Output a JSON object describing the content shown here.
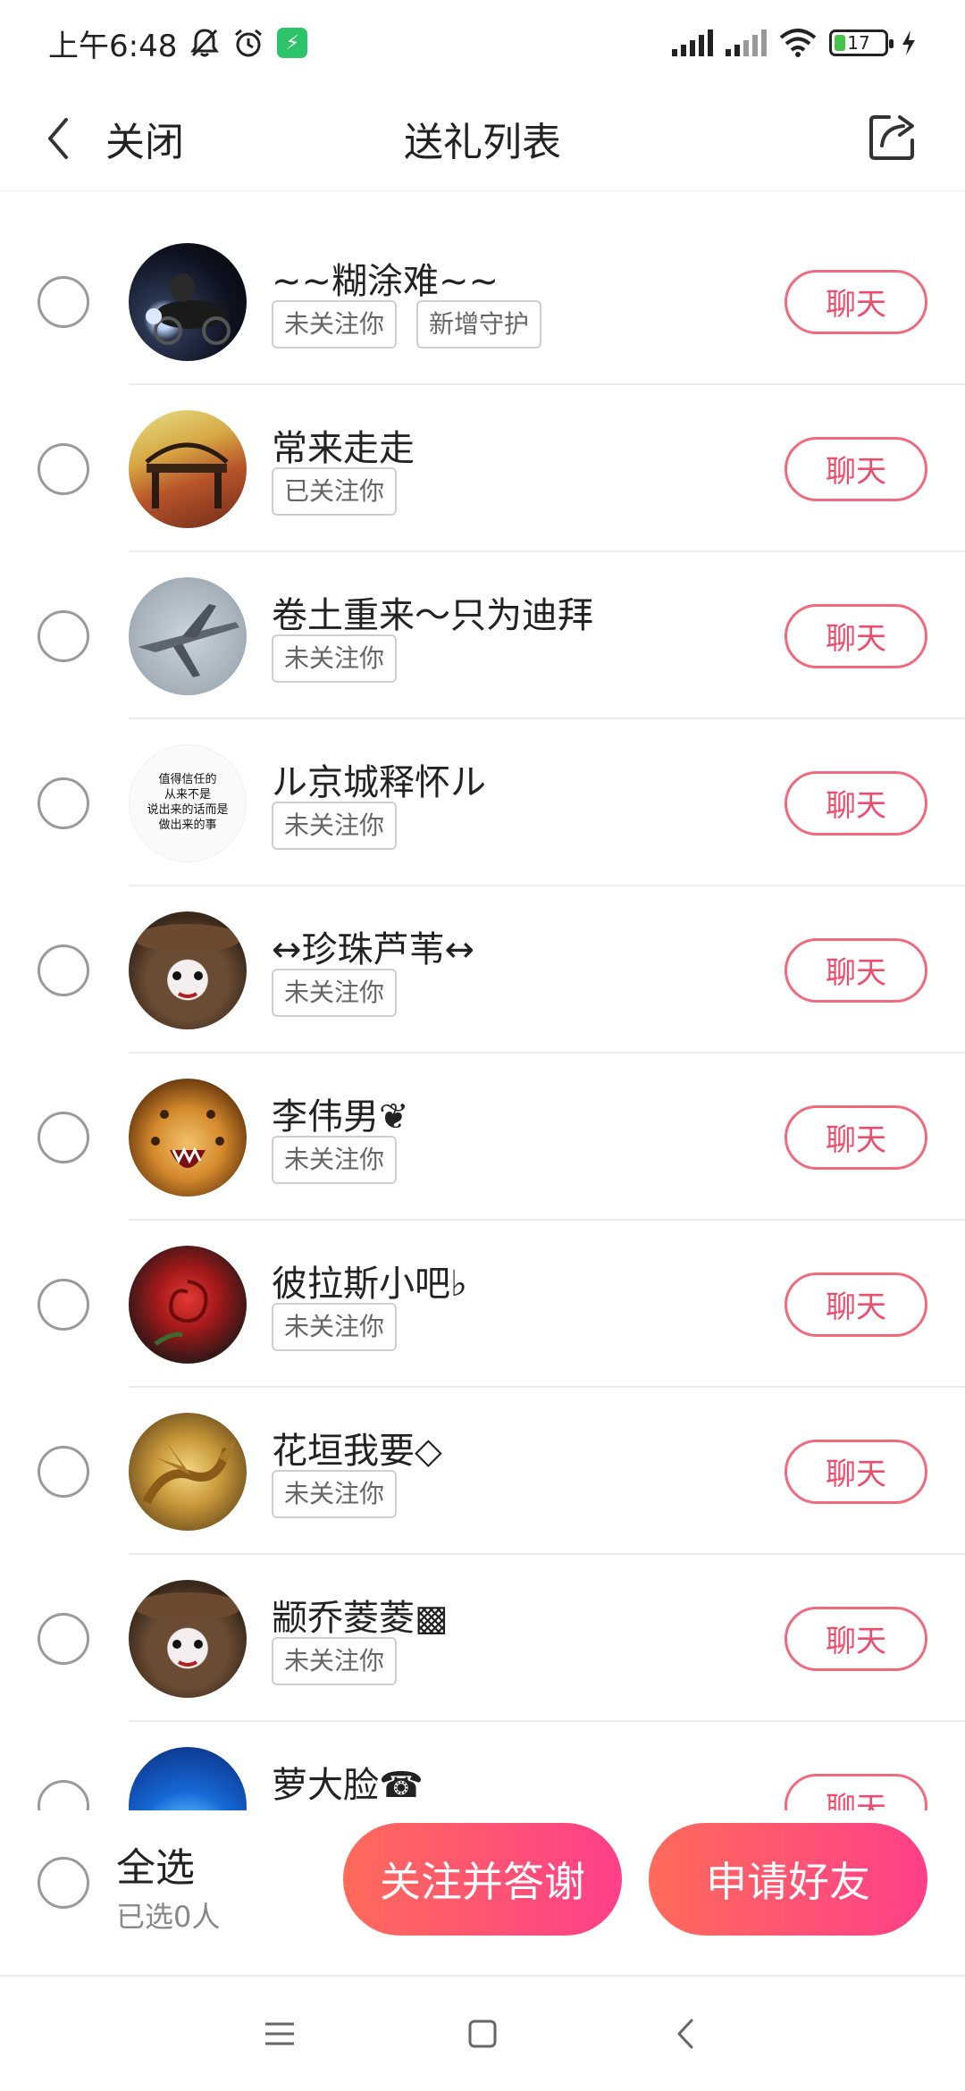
{
  "status_bar": {
    "time": "上午6:48",
    "battery_level": "17",
    "icons": [
      "mute-bell-icon",
      "alarm-icon",
      "app-notification-icon",
      "signal-icon",
      "hd-signal-icon",
      "wifi-icon",
      "battery-icon",
      "charging-icon"
    ]
  },
  "header": {
    "back_label": "关闭",
    "title": "送礼列表",
    "share_icon": "share-icon"
  },
  "list": {
    "items": [
      {
        "name": "~~糊涂难~~",
        "tags": [
          "未关注你",
          "新增守护"
        ],
        "chat_label": "聊天"
      },
      {
        "name": "常来走走",
        "tags": [
          "已关注你"
        ],
        "chat_label": "聊天"
      },
      {
        "name": "卷土重来～只为迪拜",
        "tags": [
          "未关注你"
        ],
        "chat_label": "聊天"
      },
      {
        "name": "ル京城释怀ル",
        "tags": [
          "未关注你"
        ],
        "chat_label": "聊天"
      },
      {
        "name": "↔珍珠芦苇↔",
        "tags": [
          "未关注你"
        ],
        "chat_label": "聊天"
      },
      {
        "name": "李伟男❦",
        "tags": [
          "未关注你"
        ],
        "chat_label": "聊天"
      },
      {
        "name": "彼拉斯小吧♭",
        "tags": [
          "未关注你"
        ],
        "chat_label": "聊天"
      },
      {
        "name": "花垣我要◇",
        "tags": [
          "未关注你"
        ],
        "chat_label": "聊天"
      },
      {
        "name": "颛乔菱菱▩",
        "tags": [
          "未关注你"
        ],
        "chat_label": "聊天"
      },
      {
        "name": "萝大脸☎",
        "tags": [],
        "chat_label": "聊天"
      }
    ],
    "avatar4_text": [
      "值得信任的",
      "从来不是",
      "说出来的话而是",
      "做出来的事"
    ]
  },
  "bottom": {
    "select_all": "全选",
    "selected_count": "已选0人",
    "follow_thank": "关注并答谢",
    "apply_friend": "申请好友"
  },
  "nav": {
    "icons": [
      "menu-icon",
      "home-icon",
      "back-icon"
    ]
  },
  "colors": {
    "accent": "#ec4d6c",
    "gradient_start": "#ff6b5a",
    "gradient_end": "#ff3f8a",
    "battery_green": "#48c34a"
  }
}
